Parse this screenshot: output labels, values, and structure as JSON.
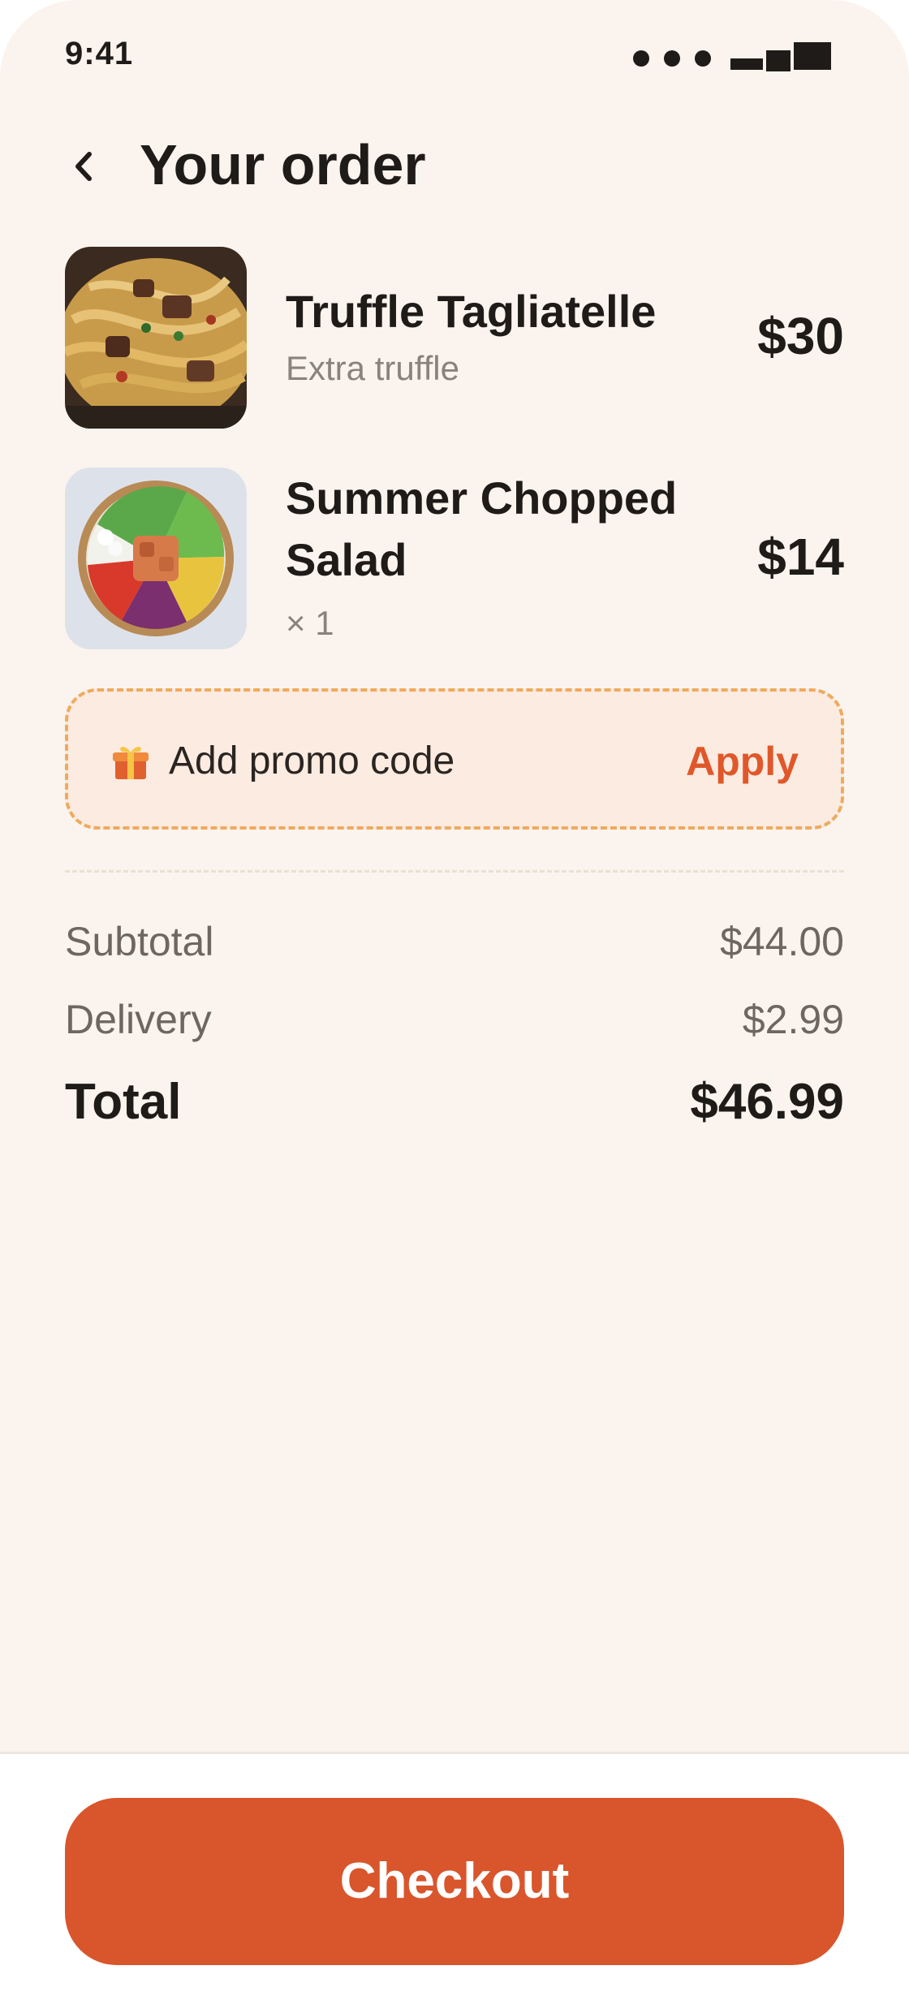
{
  "status_bar": {
    "time": "9:41"
  },
  "header": {
    "back_icon": "chevron-left-icon",
    "title": "Your order"
  },
  "items": [
    {
      "name": "Truffle Tagliatelle",
      "detail": "Extra truffle",
      "price": "$30",
      "image": "pasta-dish-photo"
    },
    {
      "name": "Summer Chopped Salad",
      "detail": "× 1",
      "price": "$14",
      "image": "salad-bowl-photo"
    }
  ],
  "promo": {
    "icon": "gift-icon",
    "label": "Add promo code",
    "apply_label": "Apply"
  },
  "summary": {
    "subtotal_label": "Subtotal",
    "subtotal_value": "$44.00",
    "delivery_label": "Delivery",
    "delivery_value": "$2.99",
    "total_label": "Total",
    "total_value": "$46.99"
  },
  "footer": {
    "checkout_label": "Checkout"
  },
  "colors": {
    "background": "#fbf4ee",
    "accent": "#d9552c",
    "promo_border": "#efaa5e"
  }
}
